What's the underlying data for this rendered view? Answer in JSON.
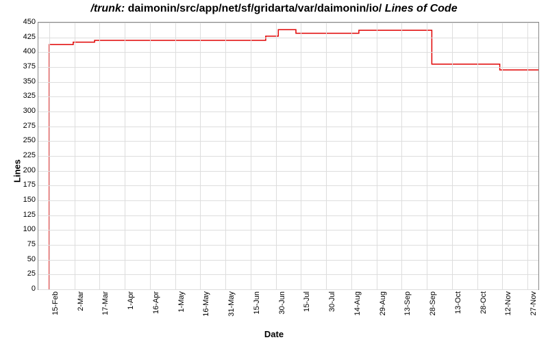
{
  "chart_data": {
    "type": "line",
    "title_prefix": "/trunk: ",
    "title_path": "daimonin/src/app/net/sf/gridarta/var/daimonin/io/",
    "title_suffix": " Lines of Code",
    "xlabel": "Date",
    "ylabel": "Lines",
    "ylim": [
      0,
      450
    ],
    "y_ticks": [
      0,
      25,
      50,
      75,
      100,
      125,
      150,
      175,
      200,
      225,
      250,
      275,
      300,
      325,
      350,
      375,
      400,
      425,
      450
    ],
    "x_ticks": [
      "15-Feb",
      "2-Mar",
      "17-Mar",
      "1-Apr",
      "16-Apr",
      "1-May",
      "16-May",
      "31-May",
      "15-Jun",
      "30-Jun",
      "15-Jul",
      "30-Jul",
      "14-Aug",
      "29-Aug",
      "13-Sep",
      "28-Sep",
      "13-Oct",
      "28-Oct",
      "12-Nov",
      "27-Nov"
    ],
    "series": [
      {
        "name": "lines-of-code",
        "color": "#e00000",
        "points": [
          {
            "x_index": 0,
            "y": 0
          },
          {
            "x_index": 0,
            "y": 413
          },
          {
            "x_index": 0.95,
            "y": 413
          },
          {
            "x_index": 0.95,
            "y": 417
          },
          {
            "x_index": 1.8,
            "y": 417
          },
          {
            "x_index": 1.8,
            "y": 420
          },
          {
            "x_index": 8.6,
            "y": 420
          },
          {
            "x_index": 8.6,
            "y": 427
          },
          {
            "x_index": 9.1,
            "y": 427
          },
          {
            "x_index": 9.1,
            "y": 438
          },
          {
            "x_index": 9.8,
            "y": 438
          },
          {
            "x_index": 9.8,
            "y": 432
          },
          {
            "x_index": 12.3,
            "y": 432
          },
          {
            "x_index": 12.3,
            "y": 437
          },
          {
            "x_index": 15.2,
            "y": 437
          },
          {
            "x_index": 15.2,
            "y": 380
          },
          {
            "x_index": 17.9,
            "y": 380
          },
          {
            "x_index": 17.9,
            "y": 370
          },
          {
            "x_index": 19.5,
            "y": 370
          },
          {
            "x_index": 19.5,
            "y": 0
          }
        ]
      }
    ]
  }
}
